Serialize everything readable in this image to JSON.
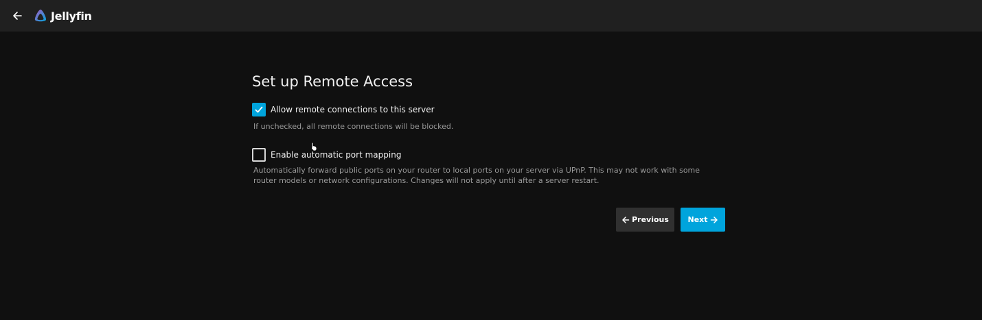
{
  "header": {
    "back_icon": "arrow-left-icon",
    "logo_icon": "jellyfin-logo-icon",
    "app_name": "Jellyfin"
  },
  "main": {
    "title": "Set up Remote Access",
    "options": [
      {
        "label": "Allow remote connections to this server",
        "description": "If unchecked, all remote connections will be blocked.",
        "checked": true
      },
      {
        "label": "Enable automatic port mapping",
        "description": "Automatically forward public ports on your router to local ports on your server via UPnP. This may not work with some router models or network configurations. Changes will not apply until after a server restart.",
        "checked": false
      }
    ]
  },
  "buttons": {
    "previous_label": "Previous",
    "next_label": "Next"
  },
  "colors": {
    "accent": "#00a4dc",
    "header_bg": "#202020",
    "page_bg": "#101010"
  }
}
